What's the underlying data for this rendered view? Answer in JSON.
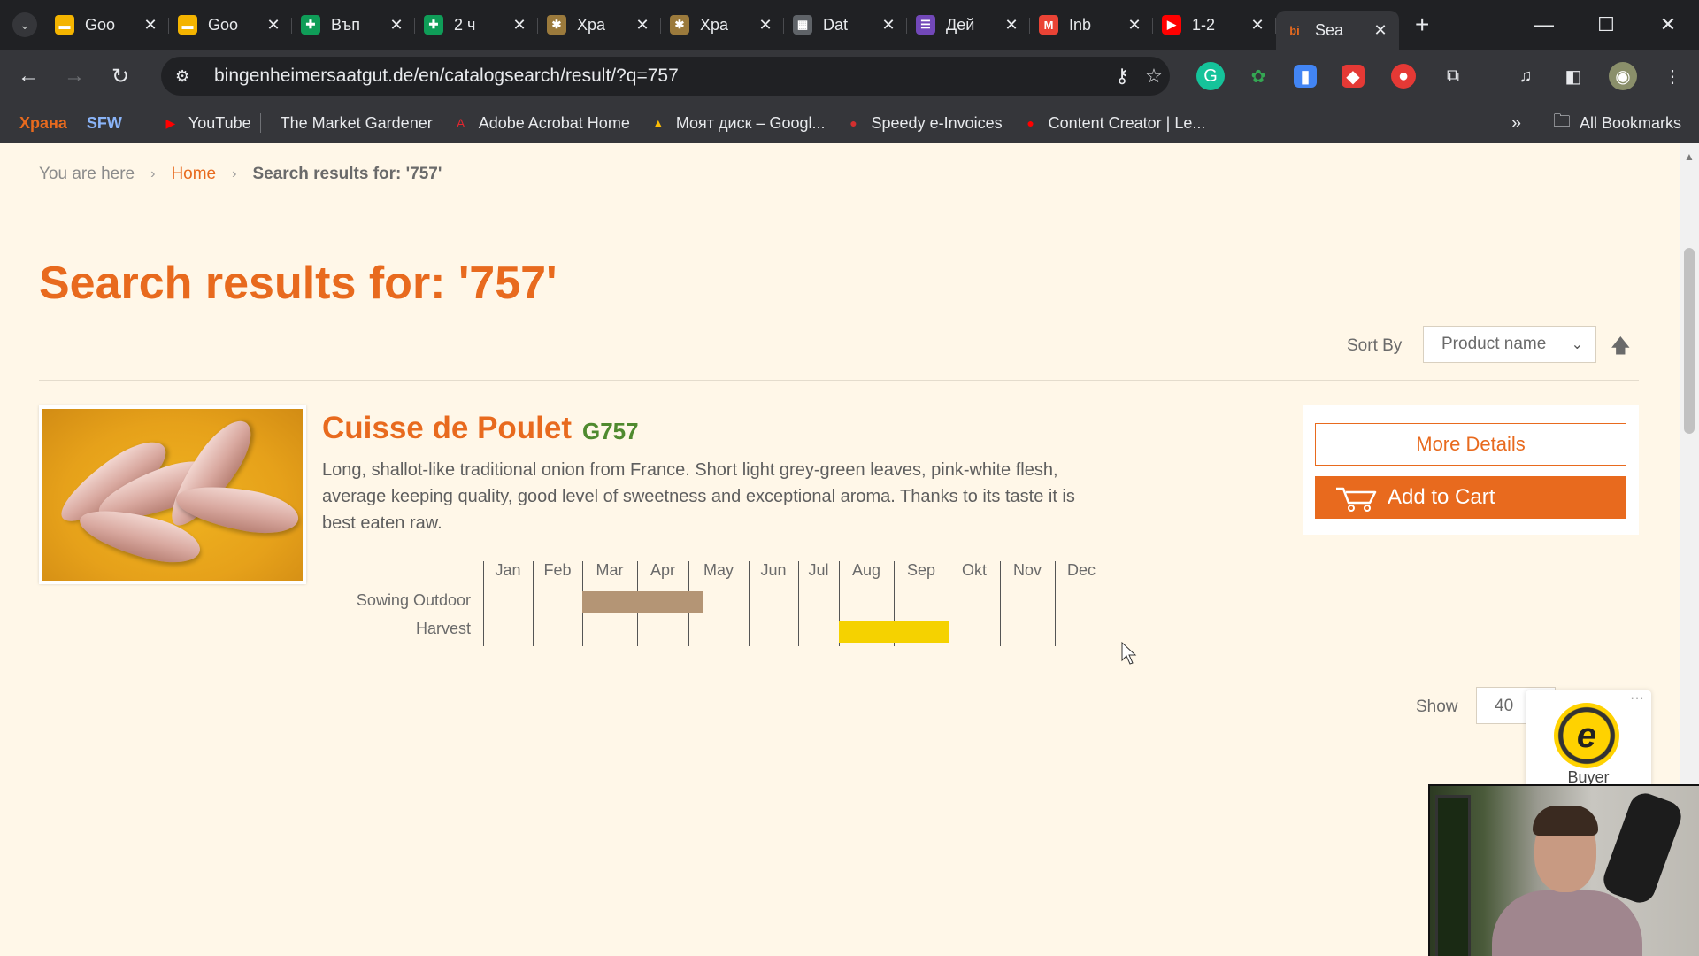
{
  "browser": {
    "tabs": [
      {
        "title": "Goo",
        "favicon": "google-slides-icon",
        "color": "#f4b400",
        "glyph": "▬"
      },
      {
        "title": "Goo",
        "favicon": "google-slides-icon",
        "color": "#f4b400",
        "glyph": "▬"
      },
      {
        "title": "Въп",
        "favicon": "google-sheets-icon",
        "color": "#0f9d58",
        "glyph": "✚"
      },
      {
        "title": "2 ч",
        "favicon": "google-sheets-icon",
        "color": "#0f9d58",
        "glyph": "✚"
      },
      {
        "title": "Хра",
        "favicon": "plant-icon",
        "color": "#9b7a3c",
        "glyph": "✱"
      },
      {
        "title": "Хра",
        "favicon": "plant-icon",
        "color": "#9b7a3c",
        "glyph": "✱"
      },
      {
        "title": "Dat",
        "favicon": "table-icon",
        "color": "#5f6368",
        "glyph": "▦"
      },
      {
        "title": "Дей",
        "favicon": "forms-icon",
        "color": "#7248b9",
        "glyph": "☰"
      },
      {
        "title": "Inb",
        "favicon": "gmail-icon",
        "color": "#ea4335",
        "glyph": "M"
      },
      {
        "title": "1-2",
        "favicon": "youtube-icon",
        "color": "#ff0000",
        "glyph": "▶"
      },
      {
        "title": "Sea",
        "favicon": "bingenheimer-icon",
        "color": "#e86a1e",
        "glyph": "bi",
        "active": true
      }
    ],
    "url": "bingenheimersaatgut.de/en/catalogsearch/result/?q=757",
    "bookmarks": [
      {
        "label": "Храна",
        "icon": "",
        "bold": true,
        "color": "#e86a1e"
      },
      {
        "label": "SFW",
        "icon": "",
        "bold": true,
        "color": "#8ab4f8"
      },
      {
        "label": "YouTube",
        "icon": "youtube-icon",
        "color": "#ff0000",
        "glyph": "▶"
      },
      {
        "label": "The Market Gardener",
        "icon": "",
        "color": "",
        "glyph": ""
      },
      {
        "label": "Adobe Acrobat Home",
        "icon": "acrobat-icon",
        "color": "#e3262f",
        "glyph": "A"
      },
      {
        "label": "Моят диск – Googl...",
        "icon": "drive-icon",
        "color": "#fbbc04",
        "glyph": "▲"
      },
      {
        "label": "Speedy e-Invoices",
        "icon": "speedy-icon",
        "color": "#d32f2f",
        "glyph": "●"
      },
      {
        "label": "Content Creator | Le...",
        "icon": "youtube-icon",
        "color": "#ff0000",
        "glyph": "●"
      }
    ],
    "all_bookmarks": "All Bookmarks"
  },
  "page": {
    "breadcrumb": {
      "you_are_here": "You are here",
      "home": "Home",
      "current": "Search results for: '757'"
    },
    "heading": "Search results for: '757'",
    "sort": {
      "label": "Sort By",
      "selected": "Product name"
    },
    "product": {
      "name": "Cuisse de Poulet",
      "code": "G757",
      "description": "Long, shallot-like traditional onion from France. Short light grey-green leaves, pink-white flesh, average keeping quality, good level of sweetness and exceptional aroma. Thanks to its taste it is best eaten raw.",
      "more_details": "More Details",
      "add_to_cart": "Add to Cart",
      "calendar": {
        "months": [
          "Jan",
          "Feb",
          "Mar",
          "Apr",
          "May",
          "Jun",
          "Jul",
          "Aug",
          "Sep",
          "Okt",
          "Nov",
          "Dec"
        ],
        "rows": [
          {
            "label": "Sowing Outdoor",
            "months": [
              "Mar",
              "Apr",
              "May"
            ],
            "color": "#b49575"
          },
          {
            "label": "Harvest",
            "months": [
              "Aug",
              "Sep"
            ],
            "color": "#f5d200"
          }
        ]
      }
    },
    "show": {
      "label": "Show",
      "selected": "40"
    },
    "trusted_shops": {
      "badge": "e",
      "text": "Buyer"
    }
  },
  "colors": {
    "accent": "#e86a1e",
    "code_green": "#4f8a2f",
    "page_bg": "#fff7e8"
  }
}
